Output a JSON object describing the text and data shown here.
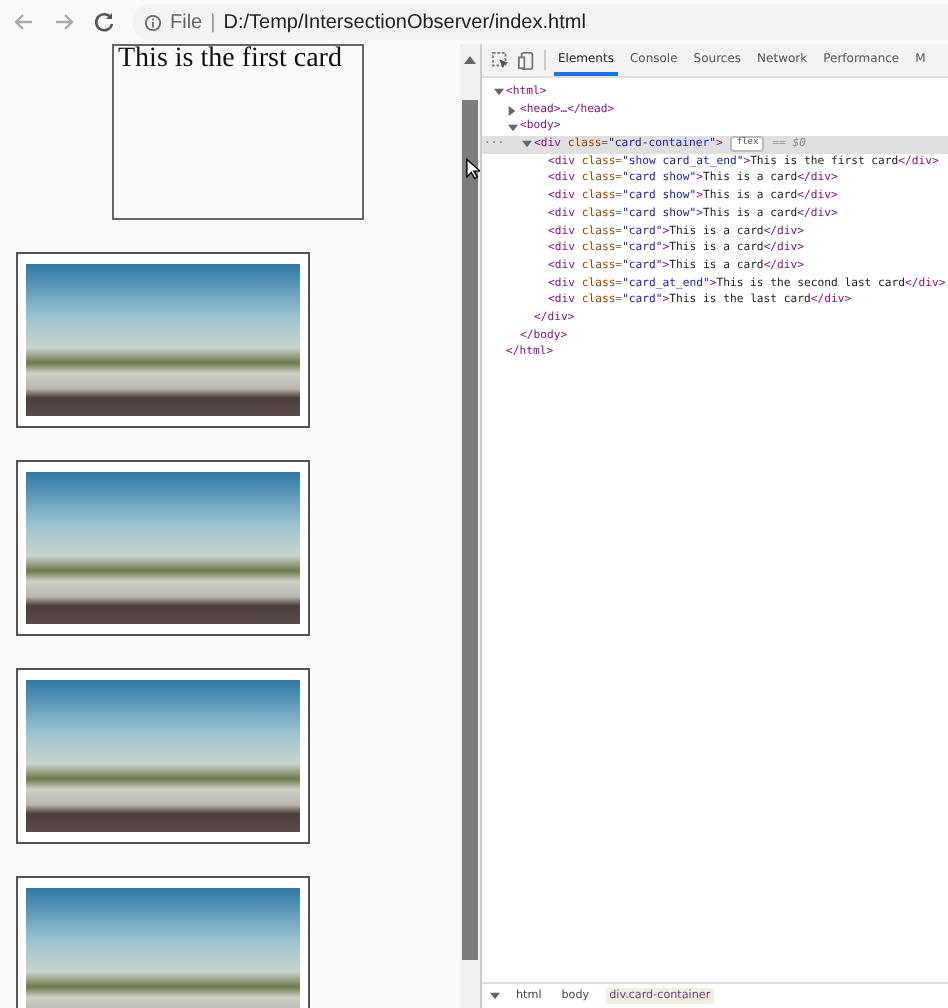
{
  "address_bar": {
    "scheme_label": "File",
    "separator": "|",
    "url": "D:/Temp/IntersectionObserver/index.html"
  },
  "page": {
    "first_card": {
      "text": "This is the first card"
    },
    "image_cards": [
      {
        "kind": "photo"
      },
      {
        "kind": "photo"
      },
      {
        "kind": "photo"
      },
      {
        "kind": "photo"
      }
    ]
  },
  "devtools": {
    "tabs": [
      {
        "label": "Elements",
        "selected": true
      },
      {
        "label": "Console",
        "selected": false
      },
      {
        "label": "Sources",
        "selected": false
      },
      {
        "label": "Network",
        "selected": false
      },
      {
        "label": "Performance",
        "selected": false
      },
      {
        "label": "M",
        "selected": false
      }
    ],
    "dom_tree": [
      {
        "parts": [
          {
            "kind": "tag",
            "text": "<html>"
          }
        ],
        "close": "</html>",
        "expanded": true,
        "selected": false,
        "children": [
          {
            "parts": [
              {
                "kind": "tag",
                "text": "<head>…</head>"
              }
            ],
            "expanded": false,
            "selected": false
          },
          {
            "parts": [
              {
                "kind": "tag",
                "text": "<body>"
              }
            ],
            "close": "</body>",
            "expanded": true,
            "selected": false,
            "children": [
              {
                "gutter": "···",
                "parts": [
                  {
                    "kind": "tag",
                    "text": "<div "
                  },
                  {
                    "kind": "attr",
                    "text": "class="
                  },
                  {
                    "kind": "value",
                    "text": "\"card-container\""
                  },
                  {
                    "kind": "tag",
                    "text": ">"
                  }
                ],
                "badge": "flex",
                "suffix": "== $0",
                "close": "</div>",
                "expanded": true,
                "selected": true,
                "children": [
                  {
                    "parts": [
                      {
                        "kind": "tag",
                        "text": "<div "
                      },
                      {
                        "kind": "attr",
                        "text": "class="
                      },
                      {
                        "kind": "value",
                        "text": "\"show card_at_end\""
                      },
                      {
                        "kind": "tag",
                        "text": ">"
                      },
                      {
                        "kind": "text",
                        "text": "This is the first card"
                      },
                      {
                        "kind": "tag",
                        "text": "</div>"
                      }
                    ],
                    "selected": false
                  },
                  {
                    "parts": [
                      {
                        "kind": "tag",
                        "text": "<div "
                      },
                      {
                        "kind": "attr",
                        "text": "class="
                      },
                      {
                        "kind": "value",
                        "text": "\"card show\""
                      },
                      {
                        "kind": "tag",
                        "text": ">"
                      },
                      {
                        "kind": "text",
                        "text": "This is a card"
                      },
                      {
                        "kind": "tag",
                        "text": "</div>"
                      }
                    ],
                    "selected": false
                  },
                  {
                    "parts": [
                      {
                        "kind": "tag",
                        "text": "<div "
                      },
                      {
                        "kind": "attr",
                        "text": "class="
                      },
                      {
                        "kind": "value",
                        "text": "\"card show\""
                      },
                      {
                        "kind": "tag",
                        "text": ">"
                      },
                      {
                        "kind": "text",
                        "text": "This is a card"
                      },
                      {
                        "kind": "tag",
                        "text": "</div>"
                      }
                    ],
                    "selected": false
                  },
                  {
                    "parts": [
                      {
                        "kind": "tag",
                        "text": "<div "
                      },
                      {
                        "kind": "attr",
                        "text": "class="
                      },
                      {
                        "kind": "value",
                        "text": "\"card show\""
                      },
                      {
                        "kind": "tag",
                        "text": ">"
                      },
                      {
                        "kind": "text",
                        "text": "This is a card"
                      },
                      {
                        "kind": "tag",
                        "text": "</div>"
                      }
                    ],
                    "selected": false
                  },
                  {
                    "parts": [
                      {
                        "kind": "tag",
                        "text": "<div "
                      },
                      {
                        "kind": "attr",
                        "text": "class="
                      },
                      {
                        "kind": "value",
                        "text": "\"card\""
                      },
                      {
                        "kind": "tag",
                        "text": ">"
                      },
                      {
                        "kind": "text",
                        "text": "This is a card"
                      },
                      {
                        "kind": "tag",
                        "text": "</div>"
                      }
                    ],
                    "selected": false
                  },
                  {
                    "parts": [
                      {
                        "kind": "tag",
                        "text": "<div "
                      },
                      {
                        "kind": "attr",
                        "text": "class="
                      },
                      {
                        "kind": "value",
                        "text": "\"card\""
                      },
                      {
                        "kind": "tag",
                        "text": ">"
                      },
                      {
                        "kind": "text",
                        "text": "This is a card"
                      },
                      {
                        "kind": "tag",
                        "text": "</div>"
                      }
                    ],
                    "selected": false
                  },
                  {
                    "parts": [
                      {
                        "kind": "tag",
                        "text": "<div "
                      },
                      {
                        "kind": "attr",
                        "text": "class="
                      },
                      {
                        "kind": "value",
                        "text": "\"card\""
                      },
                      {
                        "kind": "tag",
                        "text": ">"
                      },
                      {
                        "kind": "text",
                        "text": "This is a card"
                      },
                      {
                        "kind": "tag",
                        "text": "</div>"
                      }
                    ],
                    "selected": false
                  },
                  {
                    "parts": [
                      {
                        "kind": "tag",
                        "text": "<div "
                      },
                      {
                        "kind": "attr",
                        "text": "class="
                      },
                      {
                        "kind": "value",
                        "text": "\"card_at_end\""
                      },
                      {
                        "kind": "tag",
                        "text": ">"
                      },
                      {
                        "kind": "text",
                        "text": "This is the second last card"
                      },
                      {
                        "kind": "tag",
                        "text": "</div>"
                      }
                    ],
                    "selected": false
                  },
                  {
                    "parts": [
                      {
                        "kind": "tag",
                        "text": "<div "
                      },
                      {
                        "kind": "attr",
                        "text": "class="
                      },
                      {
                        "kind": "value",
                        "text": "\"card\""
                      },
                      {
                        "kind": "tag",
                        "text": ">"
                      },
                      {
                        "kind": "text",
                        "text": "This is the last card"
                      },
                      {
                        "kind": "tag",
                        "text": "</div>"
                      }
                    ],
                    "selected": false
                  }
                ]
              }
            ]
          }
        ]
      }
    ],
    "breadcrumbs": [
      {
        "label": "html",
        "selected": false
      },
      {
        "label": "body",
        "selected": false
      },
      {
        "label": "div.card-container",
        "selected": true
      }
    ]
  }
}
